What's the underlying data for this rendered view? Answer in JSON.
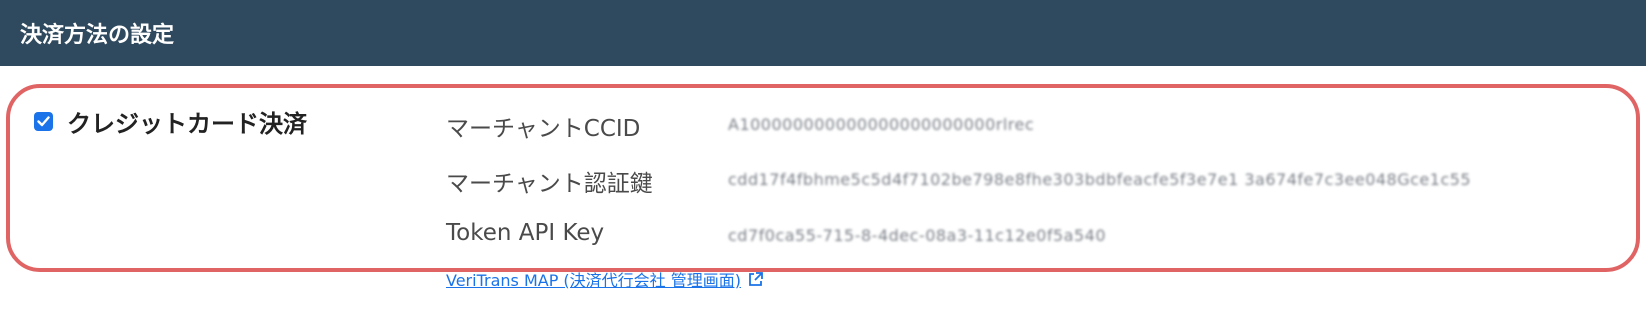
{
  "header": {
    "title": "決済方法の設定"
  },
  "payment_method": {
    "label": "クレジットカード決済",
    "checked": true,
    "fields": [
      {
        "label": "マーチャントCCID",
        "value": "A100000000000000000000000rlrec"
      },
      {
        "label": "マーチャント認証鍵",
        "value": "cdd17f4fbhme5c5d4f7102be798e8fhe303bdbfeacfe5f3e7e1 3a674fe7c3ee048Gce1c55"
      },
      {
        "label": "Token API Key",
        "value": "cd7f0ca55-715-8-4dec-08a3-11c12e0f5a540"
      }
    ]
  },
  "link": {
    "label": "VeriTrans MAP (決済代行会社 管理画面)",
    "icon": "external-link-icon"
  },
  "colors": {
    "header_bg": "#2f4a5e",
    "highlight_border": "#e06464",
    "accent": "#1a73e8"
  }
}
